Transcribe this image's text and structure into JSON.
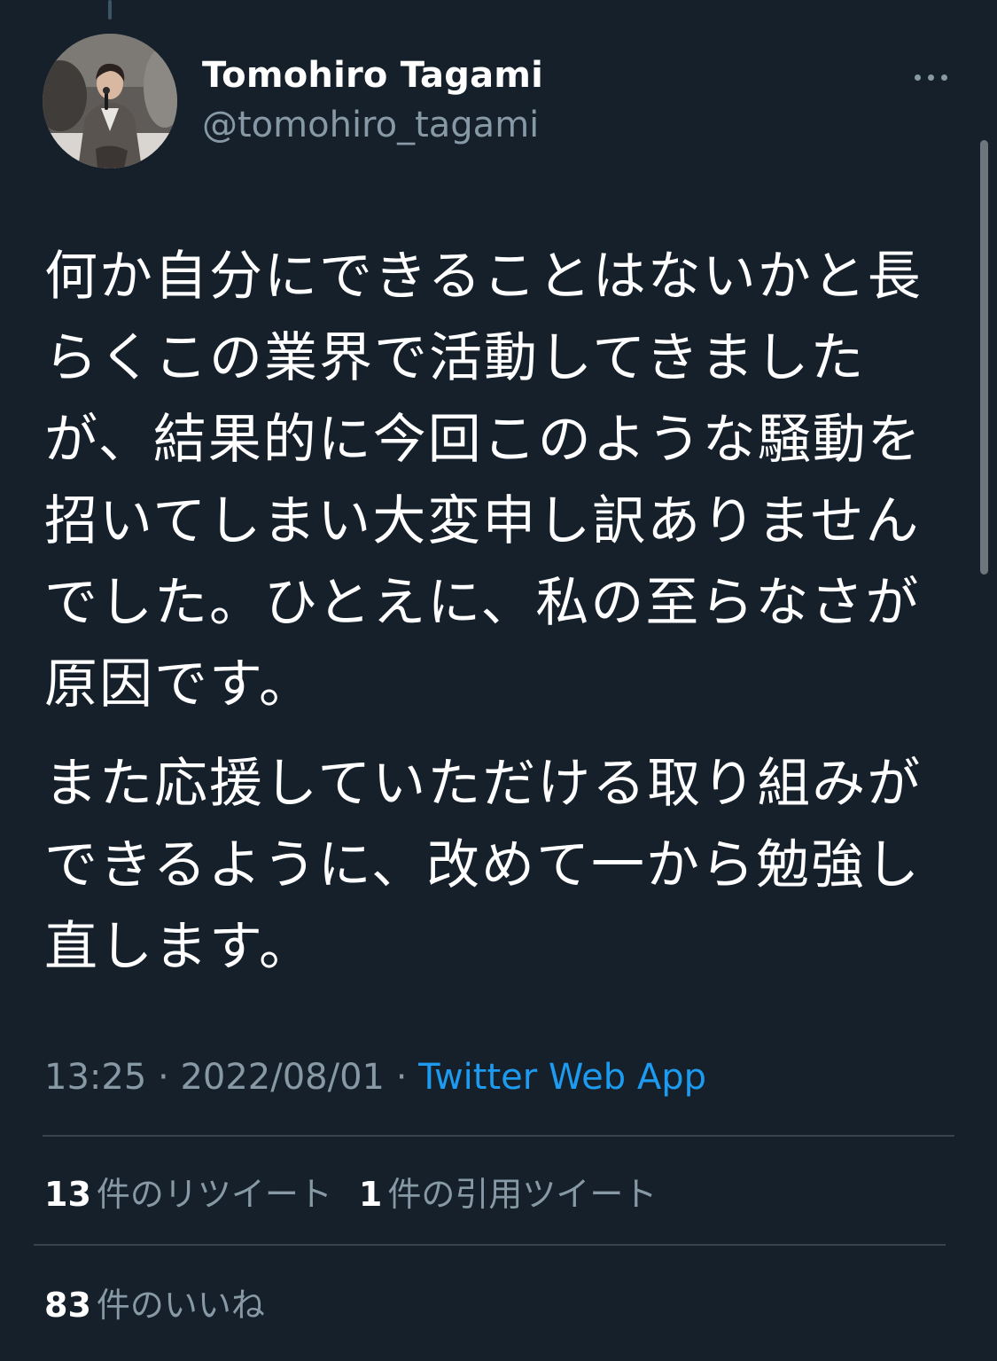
{
  "tweet": {
    "display_name": "Tomohiro Tagami",
    "handle": "@tomohiro_tagami",
    "paragraphs": [
      "何か自分にできることはないかと長らくこの業界で活動してきましたが、結果的に今回このような騒動を招いてしまい大変申し訳ありませんでした。ひとえに、私の至らなさが原因です。",
      "また応援していただける取り組みができるように、改めて一から勉強し直します。"
    ],
    "time": "13:25",
    "separator": "·",
    "date": "2022/08/01",
    "source": "Twitter Web App"
  },
  "stats": {
    "retweets_count": "13",
    "retweets_label": "件のリツイート",
    "quotes_count": "1",
    "quotes_label": "件の引用ツイート",
    "likes_count": "83",
    "likes_label": "件のいいね"
  },
  "icons": {
    "more": "more-horizontal-icon"
  },
  "colors": {
    "background": "#15202b",
    "secondary_text": "#8899a6",
    "link": "#1d9bf0",
    "divider": "#38444d"
  }
}
